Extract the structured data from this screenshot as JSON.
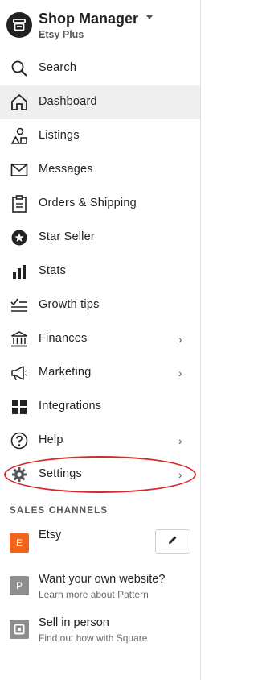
{
  "header": {
    "title": "Shop Manager",
    "subtitle": "Etsy Plus"
  },
  "nav": [
    {
      "label": "Search",
      "icon": "search-icon"
    },
    {
      "label": "Dashboard",
      "icon": "home-icon",
      "active": true
    },
    {
      "label": "Listings",
      "icon": "listings-icon"
    },
    {
      "label": "Messages",
      "icon": "envelope-icon"
    },
    {
      "label": "Orders & Shipping",
      "icon": "clipboard-icon"
    },
    {
      "label": "Star Seller",
      "icon": "star-badge-icon"
    },
    {
      "label": "Stats",
      "icon": "bar-chart-icon"
    },
    {
      "label": "Growth tips",
      "icon": "checklist-icon"
    },
    {
      "label": "Finances",
      "icon": "bank-icon",
      "chevron": true
    },
    {
      "label": "Marketing",
      "icon": "megaphone-icon",
      "chevron": true
    },
    {
      "label": "Integrations",
      "icon": "grid-icon"
    },
    {
      "label": "Help",
      "icon": "question-icon",
      "chevron": true
    },
    {
      "label": "Settings",
      "icon": "gear-icon",
      "chevron": true
    }
  ],
  "sales_channels": {
    "heading": "SALES CHANNELS",
    "items": [
      {
        "badge": "E",
        "name": "Etsy",
        "sub": "",
        "badge_color": "#f1641e"
      },
      {
        "badge": "P",
        "name": "Want your own website?",
        "sub": "Learn more about Pattern",
        "badge_color": "#8f8f8f"
      },
      {
        "badge": "",
        "name": "Sell in person",
        "sub": "Find out how with Square",
        "badge_color": "#8f8f8f"
      }
    ]
  },
  "colors": {
    "accent": "#f1641e",
    "active_bg": "#efefef",
    "annotation": "#d42a2a"
  }
}
